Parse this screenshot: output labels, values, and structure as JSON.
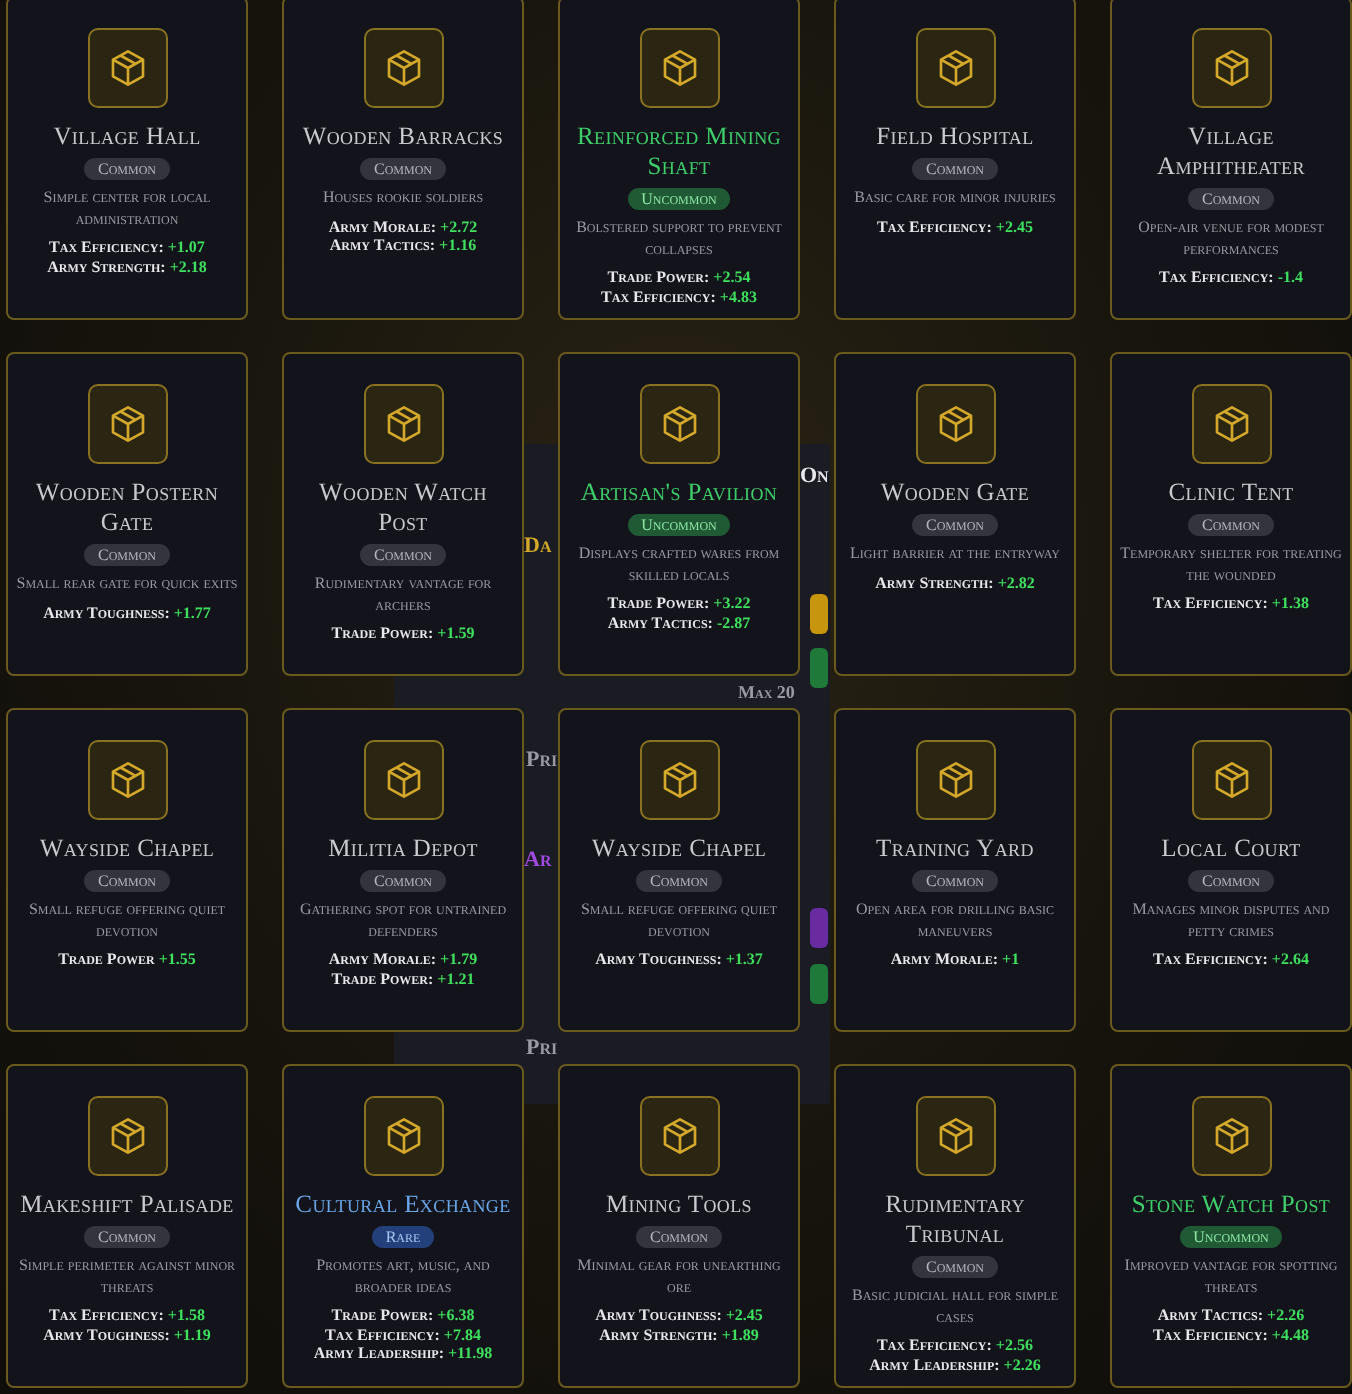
{
  "background": {
    "texts": [
      "On",
      "Da",
      "Max 20",
      "Pri",
      "Ar",
      "Pri"
    ],
    "buttons": [
      {
        "color": "#c8960c"
      },
      {
        "color": "#1f7a3a"
      },
      {
        "color": "#6a2aa0"
      },
      {
        "color": "#1f7a3a"
      }
    ]
  },
  "cards": [
    {
      "title": "Village Hall",
      "kind": "common",
      "badge": "Common",
      "description": "Simple center for local administration",
      "stats": [
        {
          "label": "Tax Efficiency:",
          "value": "+1.07"
        },
        {
          "label": "Army Strength:",
          "value": "+2.18"
        }
      ]
    },
    {
      "title": "Wooden Barracks",
      "kind": "common",
      "badge": "Common",
      "description": "Houses rookie soldiers",
      "stats": [
        {
          "label": "Army Morale:",
          "value": "+2.72"
        },
        {
          "label": "Army Tactics:",
          "value": "+1.16"
        }
      ]
    },
    {
      "title": "Reinforced Mining Shaft",
      "kind": "uncommon",
      "badge": "Uncommon",
      "description": "Bolstered support to prevent collapses",
      "stats": [
        {
          "label": "Trade Power:",
          "value": "+2.54"
        },
        {
          "label": "Tax Efficiency:",
          "value": "+4.83"
        }
      ]
    },
    {
      "title": "Field Hospital",
      "kind": "common",
      "badge": "Common",
      "description": "Basic care for minor injuries",
      "stats": [
        {
          "label": "Tax Efficiency:",
          "value": "+2.45"
        }
      ]
    },
    {
      "title": "Village Amphitheater",
      "kind": "common",
      "badge": "Common",
      "description": "Open-air venue for modest performances",
      "stats": [
        {
          "label": "Tax Efficiency:",
          "value": "-1.4"
        }
      ]
    },
    {
      "title": "Wooden Postern Gate",
      "kind": "common",
      "badge": "Common",
      "description": "Small rear gate for quick exits",
      "stats": [
        {
          "label": "Army Toughness:",
          "value": "+1.77"
        }
      ]
    },
    {
      "title": "Wooden Watch Post",
      "kind": "common",
      "badge": "Common",
      "description": "Rudimentary vantage for archers",
      "stats": [
        {
          "label": "Trade Power:",
          "value": "+1.59"
        }
      ]
    },
    {
      "title": "Artisan's Pavilion",
      "kind": "uncommon",
      "badge": "Uncommon",
      "description": "Displays crafted wares from skilled locals",
      "stats": [
        {
          "label": "Trade Power:",
          "value": "+3.22"
        },
        {
          "label": "Army Tactics:",
          "value": "-2.87"
        }
      ]
    },
    {
      "title": "Wooden Gate",
      "kind": "common",
      "badge": "Common",
      "description": "Light barrier at the entryway",
      "stats": [
        {
          "label": "Army Strength:",
          "value": "+2.82"
        }
      ]
    },
    {
      "title": "Clinic Tent",
      "kind": "common",
      "badge": "Common",
      "description": "Temporary shelter for treating the wounded",
      "stats": [
        {
          "label": "Tax Efficiency:",
          "value": "+1.38"
        }
      ]
    },
    {
      "title": "Wayside Chapel",
      "kind": "common",
      "badge": "Common",
      "description": "Small refuge offering quiet devotion",
      "stats": [
        {
          "label": "Trade Power",
          "value": "+1.55"
        }
      ]
    },
    {
      "title": "Militia Depot",
      "kind": "common",
      "badge": "Common",
      "description": "Gathering spot for untrained defenders",
      "stats": [
        {
          "label": "Army Morale:",
          "value": "+1.79"
        },
        {
          "label": "Trade Power:",
          "value": "+1.21"
        }
      ]
    },
    {
      "title": "Wayside Chapel",
      "kind": "common",
      "badge": "Common",
      "description": "Small refuge offering quiet devotion",
      "stats": [
        {
          "label": "Army Toughness:",
          "value": "+1.37"
        }
      ]
    },
    {
      "title": "Training Yard",
      "kind": "common",
      "badge": "Common",
      "description": "Open area for drilling basic maneuvers",
      "stats": [
        {
          "label": "Army Morale:",
          "value": "+1"
        }
      ]
    },
    {
      "title": "Local Court",
      "kind": "common",
      "badge": "Common",
      "description": "Manages minor disputes and petty crimes",
      "stats": [
        {
          "label": "Tax Efficiency:",
          "value": "+2.64"
        }
      ]
    },
    {
      "title": "Makeshift Palisade",
      "kind": "common",
      "badge": "Common",
      "description": "Simple perimeter against minor threats",
      "stats": [
        {
          "label": "Tax Efficiency:",
          "value": "+1.58"
        },
        {
          "label": "Army Toughness:",
          "value": "+1.19"
        }
      ]
    },
    {
      "title": "Cultural Exchange",
      "kind": "rare",
      "badge": "Rare",
      "description": "Promotes art, music, and broader ideas",
      "stats": [
        {
          "label": "Trade Power:",
          "value": "+6.38"
        },
        {
          "label": "Tax Efficiency:",
          "value": "+7.84"
        },
        {
          "label": "Army Leadership:",
          "value": "+11.98"
        }
      ]
    },
    {
      "title": "Mining Tools",
      "kind": "common",
      "badge": "Common",
      "description": "Minimal gear for unearthing ore",
      "stats": [
        {
          "label": "Army Toughness:",
          "value": "+2.45"
        },
        {
          "label": "Army Strength:",
          "value": "+1.89"
        }
      ]
    },
    {
      "title": "Rudimentary Tribunal",
      "kind": "common",
      "badge": "Common",
      "description": "Basic judicial hall for simple cases",
      "stats": [
        {
          "label": "Tax Efficiency:",
          "value": "+2.56"
        },
        {
          "label": "Army Leadership:",
          "value": "+2.26"
        }
      ]
    },
    {
      "title": "Stone Watch Post",
      "kind": "uncommon",
      "badge": "Uncommon",
      "description": "Improved vantage for spotting threats",
      "stats": [
        {
          "label": "Army Tactics:",
          "value": "+2.26"
        },
        {
          "label": "Tax Efficiency:",
          "value": "+4.48"
        }
      ]
    }
  ]
}
